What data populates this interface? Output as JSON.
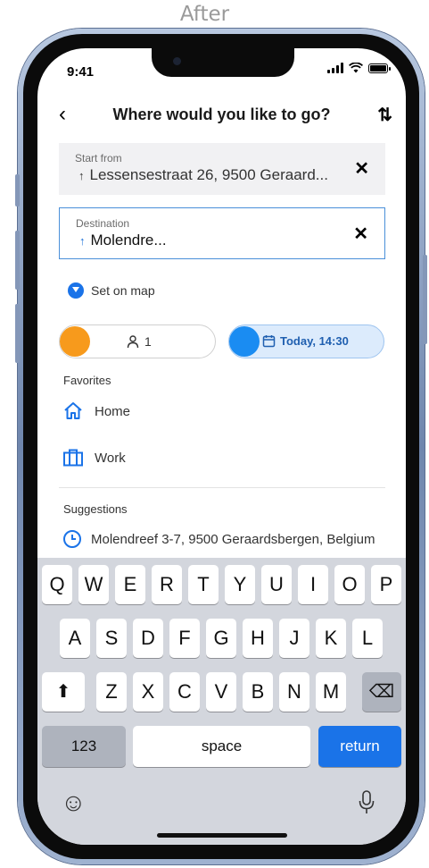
{
  "caption": "After",
  "status_bar": {
    "time": "9:41"
  },
  "header": {
    "back_icon": "‹",
    "title": "Where would you like to go?",
    "swap_icon": "⇅"
  },
  "start_field": {
    "label": "Start from",
    "arrow": "↑",
    "value": "Lessensestraat 26, 9500 Geraard...",
    "clear_icon": "✕"
  },
  "destination_field": {
    "label": "Destination",
    "arrow": "↑",
    "value": "Molendre...",
    "clear_icon": "✕"
  },
  "map_link": {
    "label": "Set on map"
  },
  "passengers_pill": {
    "count": "1",
    "dot_color": "#f79a1c"
  },
  "date_pill": {
    "label": "Today, 14:30",
    "dot_color": "#1a8cf2"
  },
  "favorites": {
    "title": "Favorites",
    "items": [
      {
        "label": "Home",
        "icon": "home-icon"
      },
      {
        "label": "Work",
        "icon": "briefcase-icon"
      }
    ]
  },
  "suggestions": {
    "title": "Suggestions",
    "items": [
      {
        "label": "Molendreef 3-7, 9500 Geraardsbergen, Belgium",
        "icon": "clock-icon"
      }
    ]
  },
  "keyboard": {
    "row1": [
      "Q",
      "W",
      "E",
      "R",
      "T",
      "Y",
      "U",
      "I",
      "O",
      "P"
    ],
    "row2": [
      "A",
      "S",
      "D",
      "F",
      "G",
      "H",
      "J",
      "K",
      "L"
    ],
    "row3": [
      "Z",
      "X",
      "C",
      "V",
      "B",
      "N",
      "M"
    ],
    "shift_icon": "⬆",
    "delete_icon": "⌫",
    "numbers_label": "123",
    "space_label": "space",
    "return_label": "return",
    "emoji_icon": "☺",
    "mic_icon": "mic-icon"
  },
  "colors": {
    "accent": "#1a73e8",
    "passenger_dot": "#f79a1c",
    "date_dot": "#1a8cf2",
    "date_pill_bg": "#dcebfc"
  }
}
